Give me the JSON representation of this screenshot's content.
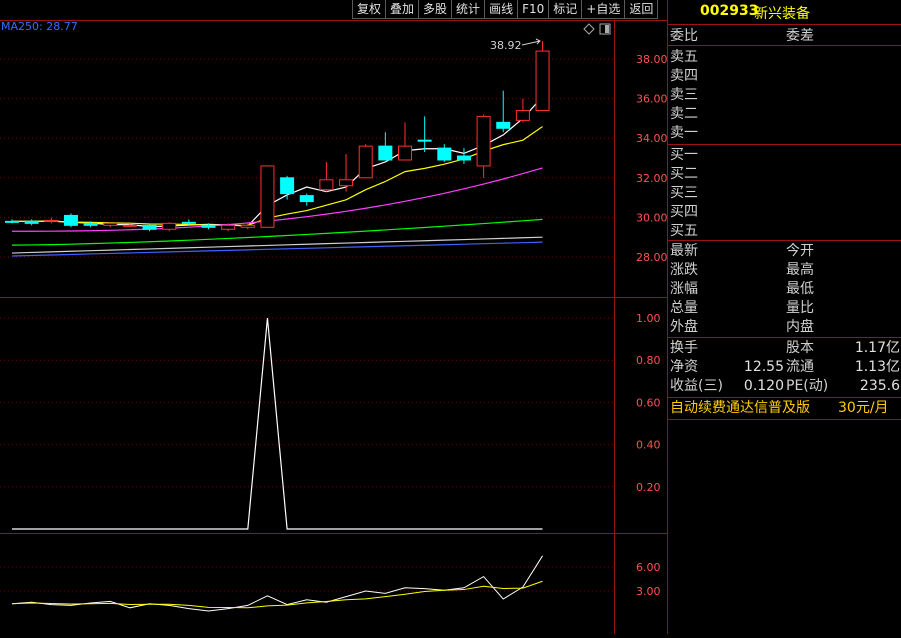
{
  "toolbar": {
    "buttons": [
      "复权",
      "叠加",
      "多股",
      "统计",
      "画线",
      "F10",
      "标记",
      "+自选",
      "返回"
    ]
  },
  "main_chart": {
    "ma_label": "MA250: 28.77",
    "price_marker": "38.92",
    "y_ticks": [
      "38.00",
      "36.00",
      "34.00",
      "32.00",
      "30.00",
      "28.00"
    ]
  },
  "volume_chart": {
    "y_ticks": [
      "1.00",
      "0.80",
      "0.60",
      "0.40",
      "0.20"
    ]
  },
  "lower_chart": {
    "y_ticks": [
      "6.00",
      "3.00"
    ]
  },
  "panel": {
    "code": "002933",
    "name": "新兴装备",
    "weibi_label": "委比",
    "weicha_label": "委差",
    "sell": [
      "卖五",
      "卖四",
      "卖三",
      "卖二",
      "卖一"
    ],
    "buy": [
      "买一",
      "买二",
      "买三",
      "买四",
      "买五"
    ],
    "stats_left": [
      "最新",
      "涨跌",
      "涨幅",
      "总量",
      "外盘"
    ],
    "stats_right": [
      "今开",
      "最高",
      "最低",
      "量比",
      "内盘"
    ],
    "fin": [
      {
        "l1": "换手",
        "v1": "",
        "l2": "股本",
        "v2": "1.17亿"
      },
      {
        "l1": "净资",
        "v1": "12.55",
        "l2": "流通",
        "v2": "1.13亿"
      },
      {
        "l1": "收益(三)",
        "v1": "0.120",
        "l2": "PE(动)",
        "v2": "235.6"
      }
    ],
    "ad_text": "自动续费通达信普及版",
    "ad_price": "30元/月"
  },
  "chart_data": {
    "type": "candlestick",
    "y_range": [
      27.5,
      39.0
    ],
    "candles": [
      {
        "o": 29.8,
        "c": 29.8,
        "h": 29.9,
        "l": 29.7,
        "up": false
      },
      {
        "o": 29.7,
        "c": 29.8,
        "h": 29.9,
        "l": 29.6,
        "up": false
      },
      {
        "o": 29.8,
        "c": 29.85,
        "h": 30.0,
        "l": 29.7,
        "up": true
      },
      {
        "o": 30.1,
        "c": 29.6,
        "h": 30.2,
        "l": 29.5,
        "up": false
      },
      {
        "o": 29.6,
        "c": 29.7,
        "h": 29.8,
        "l": 29.5,
        "up": false
      },
      {
        "o": 29.7,
        "c": 29.6,
        "h": 29.75,
        "l": 29.5,
        "up": true
      },
      {
        "o": 29.6,
        "c": 29.6,
        "h": 29.7,
        "l": 29.5,
        "up": true
      },
      {
        "o": 29.6,
        "c": 29.4,
        "h": 29.7,
        "l": 29.3,
        "up": false
      },
      {
        "o": 29.4,
        "c": 29.7,
        "h": 29.75,
        "l": 29.3,
        "up": true
      },
      {
        "o": 29.7,
        "c": 29.75,
        "h": 29.9,
        "l": 29.6,
        "up": false
      },
      {
        "o": 29.6,
        "c": 29.5,
        "h": 29.7,
        "l": 29.4,
        "up": false
      },
      {
        "o": 29.4,
        "c": 29.6,
        "h": 29.7,
        "l": 29.3,
        "up": true
      },
      {
        "o": 29.5,
        "c": 29.6,
        "h": 29.7,
        "l": 29.4,
        "up": true
      },
      {
        "o": 29.5,
        "c": 32.6,
        "h": 32.6,
        "l": 29.5,
        "up": true
      },
      {
        "o": 32.0,
        "c": 31.2,
        "h": 32.1,
        "l": 30.9,
        "up": false
      },
      {
        "o": 31.1,
        "c": 30.8,
        "h": 31.2,
        "l": 30.6,
        "up": false
      },
      {
        "o": 31.4,
        "c": 31.9,
        "h": 32.8,
        "l": 31.3,
        "up": true
      },
      {
        "o": 31.6,
        "c": 31.9,
        "h": 33.2,
        "l": 31.3,
        "up": true
      },
      {
        "o": 32.0,
        "c": 33.6,
        "h": 33.7,
        "l": 32.0,
        "up": true
      },
      {
        "o": 33.6,
        "c": 32.9,
        "h": 34.3,
        "l": 32.9,
        "up": false
      },
      {
        "o": 32.9,
        "c": 33.6,
        "h": 34.8,
        "l": 32.9,
        "up": true
      },
      {
        "o": 33.9,
        "c": 33.9,
        "h": 35.1,
        "l": 33.3,
        "up": false
      },
      {
        "o": 33.5,
        "c": 32.9,
        "h": 33.7,
        "l": 32.8,
        "up": false
      },
      {
        "o": 33.1,
        "c": 32.9,
        "h": 33.5,
        "l": 32.7,
        "up": false
      },
      {
        "o": 32.6,
        "c": 35.1,
        "h": 35.2,
        "l": 32.0,
        "up": true
      },
      {
        "o": 34.8,
        "c": 34.5,
        "h": 36.4,
        "l": 34.3,
        "up": false
      },
      {
        "o": 34.9,
        "c": 35.4,
        "h": 36.0,
        "l": 34.8,
        "up": true
      },
      {
        "o": 35.4,
        "c": 38.4,
        "h": 38.9,
        "l": 35.4,
        "up": true
      }
    ],
    "volume_series": [
      0,
      0,
      0,
      0,
      0,
      0,
      0,
      0,
      0,
      0,
      0,
      0,
      0,
      1.0,
      0,
      0,
      0,
      0,
      0,
      0,
      0,
      0,
      0,
      0,
      0,
      0,
      0,
      0
    ],
    "lower_series": [
      1.4,
      1.6,
      1.3,
      1.2,
      1.5,
      1.7,
      0.9,
      1.4,
      1.2,
      0.8,
      0.5,
      0.8,
      1.2,
      2.4,
      1.3,
      1.9,
      1.6,
      2.3,
      3.0,
      2.7,
      3.4,
      3.3,
      3.1,
      3.4,
      4.8,
      2.0,
      3.5,
      7.4
    ]
  }
}
